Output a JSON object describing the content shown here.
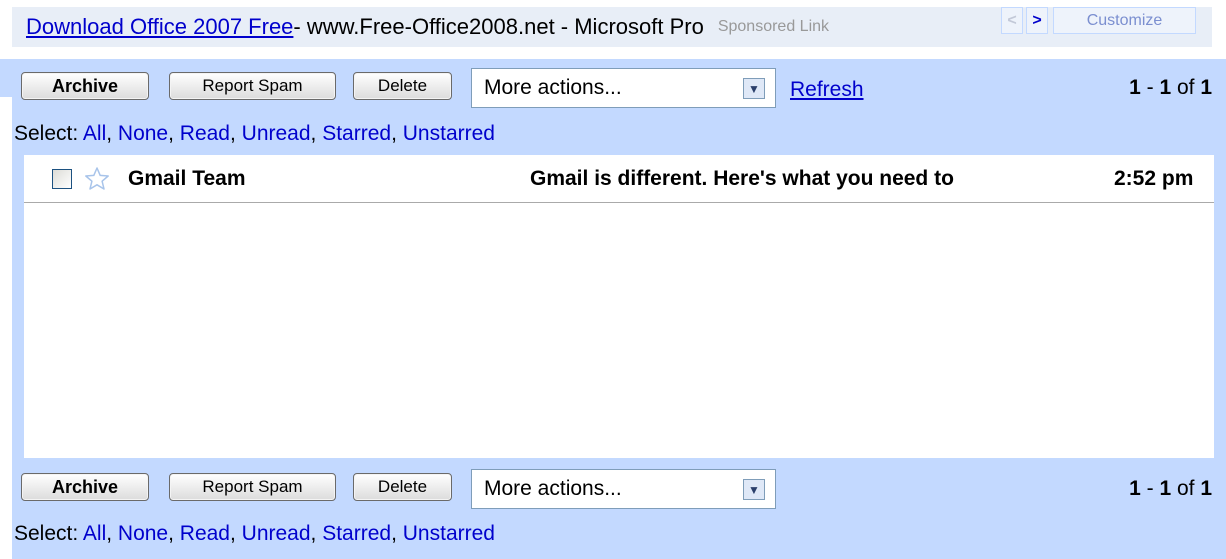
{
  "ad": {
    "title": "Download Office 2007 Free",
    "rest": " - www.Free-Office2008.net - Microsoft Pro",
    "sponsored": "Sponsored Link",
    "prev_icon": "<",
    "next_icon": ">",
    "customize": "Customize"
  },
  "toolbar_top": {
    "archive": "Archive",
    "report_spam": "Report Spam",
    "delete": "Delete",
    "more_actions": "More actions...",
    "refresh": "Refresh",
    "pager": {
      "start": "1",
      "sep": " - ",
      "end": "1",
      "of": " of ",
      "total": "1"
    }
  },
  "select_top": {
    "label": "Select: ",
    "all": "All",
    "none": "None",
    "read": "Read",
    "unread": "Unread",
    "starred": "Starred",
    "unstarred": "Unstarred",
    "comma": ", "
  },
  "messages": [
    {
      "sender": "Gmail Team",
      "subject": "Gmail is different. Here's what you need to",
      "time": "2:52 pm"
    }
  ],
  "toolbar_bottom": {
    "archive": "Archive",
    "report_spam": "Report Spam",
    "delete": "Delete",
    "more_actions": "More actions...",
    "pager": {
      "start": "1",
      "sep": " - ",
      "end": "1",
      "of": " of ",
      "total": "1"
    }
  },
  "select_bottom": {
    "label": "Select: ",
    "all": "All",
    "none": "None",
    "read": "Read",
    "unread": "Unread",
    "starred": "Starred",
    "unstarred": "Unstarred",
    "comma": ", "
  },
  "colors": {
    "panel": "#c3d9ff",
    "ad_bar": "#e8eef7",
    "link": "#0000cc"
  },
  "icons": {
    "checkbox": "checkbox-icon",
    "star": "star-outline-icon",
    "dropdown": "chevron-down-icon"
  }
}
